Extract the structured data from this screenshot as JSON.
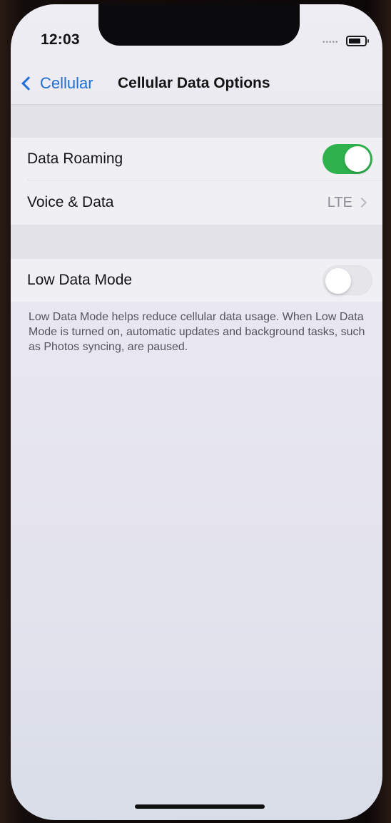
{
  "status_bar": {
    "time": "12:03",
    "signal_icon": "signal-dots-icon",
    "battery_icon": "battery-icon"
  },
  "nav": {
    "back_label": "Cellular",
    "title": "Cellular Data Options",
    "back_icon": "chevron-left-icon",
    "accent_color": "#1f6fd6"
  },
  "settings": {
    "data_roaming": {
      "label": "Data Roaming",
      "enabled": true
    },
    "voice_data": {
      "label": "Voice & Data",
      "value": "LTE"
    },
    "low_data_mode": {
      "label": "Low Data Mode",
      "enabled": false,
      "footnote": "Low Data Mode helps reduce cellular data usage. When Low Data Mode is turned on, automatic updates and background tasks, such as Photos syncing, are paused."
    }
  },
  "colors": {
    "toggle_on": "#2fb24c",
    "toggle_off": "#e6e5ea"
  }
}
